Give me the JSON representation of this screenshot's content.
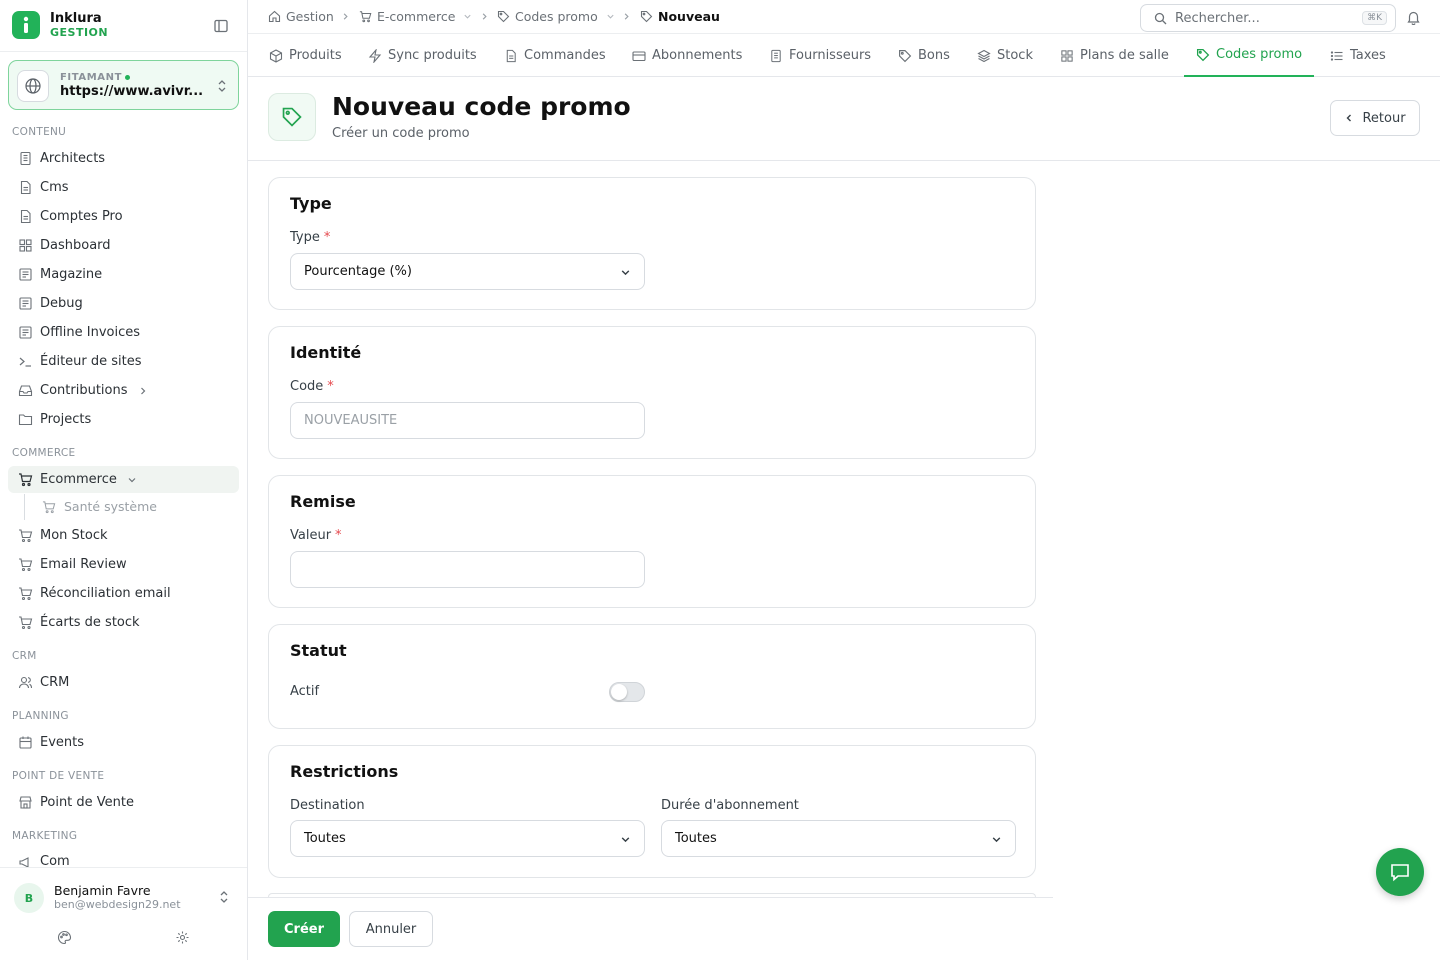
{
  "brand": {
    "name": "Inklura",
    "sub": "GESTION"
  },
  "site": {
    "label": "FITAMANT",
    "url": "https://www.avivr..."
  },
  "sidebar": {
    "sections": {
      "contenu": "CONTENU",
      "commerce": "COMMERCE",
      "crm": "CRM",
      "planning": "PLANNING",
      "pdv": "POINT DE VENTE",
      "marketing": "MARKETING"
    },
    "items": {
      "architects": "Architects",
      "cms": "Cms",
      "comptes_pro": "Comptes Pro",
      "dashboard": "Dashboard",
      "magazine": "Magazine",
      "debug": "Debug",
      "offline_invoices": "Offline Invoices",
      "editeur": "Éditeur de sites",
      "contributions": "Contributions",
      "projects": "Projects",
      "ecommerce": "Ecommerce",
      "sante": "Santé système",
      "mon_stock": "Mon Stock",
      "email_review": "Email Review",
      "reconciliation": "Réconciliation email",
      "ecarts": "Écarts de stock",
      "crm": "CRM",
      "events": "Events",
      "point_de_vente": "Point de Vente",
      "com": "Com"
    }
  },
  "user": {
    "name": "Benjamin Favre",
    "email": "ben@webdesign29.net",
    "initial": "B"
  },
  "breadcrumb": {
    "gestion": "Gestion",
    "ecommerce": "E-commerce",
    "codes_promo": "Codes promo",
    "nouveau": "Nouveau"
  },
  "search": {
    "placeholder": "Rechercher...",
    "shortcut": "⌘K"
  },
  "tabs": {
    "produits": "Produits",
    "sync": "Sync produits",
    "commandes": "Commandes",
    "abonnements": "Abonnements",
    "fournisseurs": "Fournisseurs",
    "bons": "Bons",
    "stock": "Stock",
    "plans": "Plans de salle",
    "codes_promo": "Codes promo",
    "taxes": "Taxes"
  },
  "page": {
    "title": "Nouveau code promo",
    "subtitle": "Créer un code promo",
    "back": "Retour"
  },
  "form": {
    "type": {
      "title": "Type",
      "label": "Type",
      "value": "Pourcentage (%)"
    },
    "identite": {
      "title": "Identité",
      "label": "Code",
      "placeholder": "NOUVEAUSITE"
    },
    "remise": {
      "title": "Remise",
      "label": "Valeur",
      "value": ""
    },
    "statut": {
      "title": "Statut",
      "label": "Actif",
      "active": false
    },
    "restrictions": {
      "title": "Restrictions",
      "destination_label": "Destination",
      "destination_value": "Toutes",
      "duree_label": "Durée d'abonnement",
      "duree_value": "Toutes"
    }
  },
  "actions": {
    "create": "Créer",
    "cancel": "Annuler"
  },
  "colors": {
    "accent": "#22a34f",
    "accent_light": "#effaf3",
    "border": "#e2e5e8"
  }
}
